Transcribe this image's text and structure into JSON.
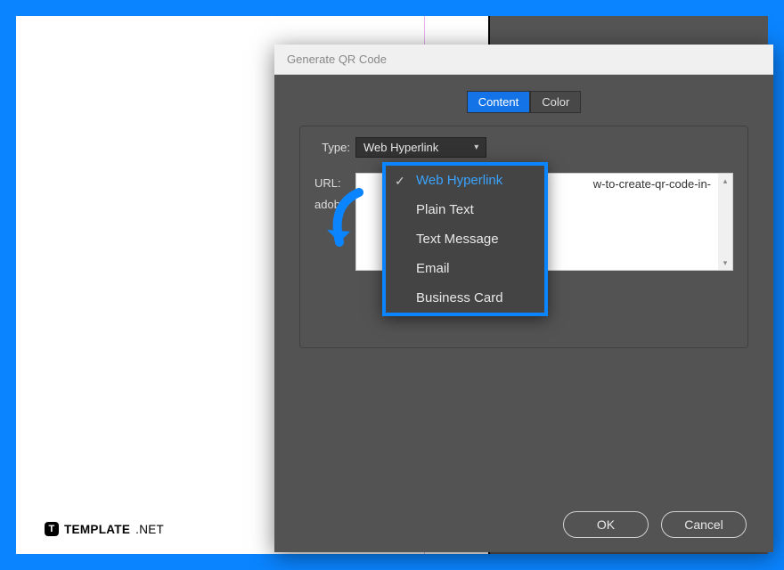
{
  "dialog": {
    "title": "Generate QR Code",
    "tabs": {
      "content": "Content",
      "color": "Color"
    },
    "type_label": "Type:",
    "type_value": "Web Hyperlink",
    "url_label": "URL:",
    "url_fragment_visible": "w-to-create-qr-code-in-",
    "adob_fragment": "adob",
    "dropdown": {
      "items": [
        "Web Hyperlink",
        "Plain Text",
        "Text Message",
        "Email",
        "Business Card"
      ],
      "selected_index": 0
    },
    "buttons": {
      "ok": "OK",
      "cancel": "Cancel"
    }
  },
  "watermark": {
    "icon_letter": "T",
    "name": "TEMPLATE",
    "suffix": ".NET"
  },
  "annotation": {
    "highlight_color": "#0a84ff"
  }
}
